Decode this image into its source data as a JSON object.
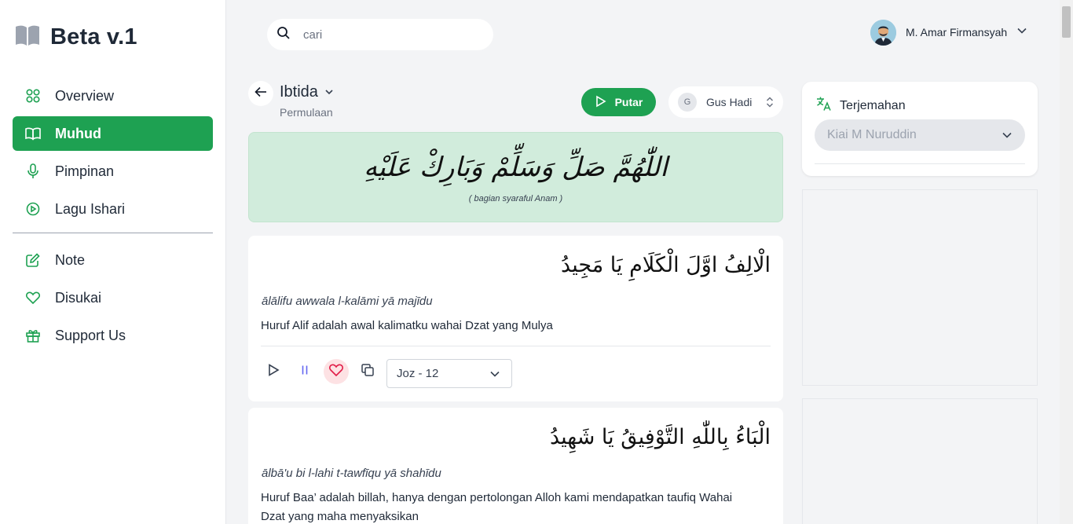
{
  "sidebar": {
    "brand": "Beta v.1",
    "items": [
      {
        "label": "Overview",
        "icon": "grid-icon"
      },
      {
        "label": "Muhud",
        "icon": "book-icon",
        "active": true
      },
      {
        "label": "Pimpinan",
        "icon": "microphone-icon"
      },
      {
        "label": "Lagu Ishari",
        "icon": "play-circle-icon"
      }
    ],
    "items2": [
      {
        "label": "Note",
        "icon": "edit-icon"
      },
      {
        "label": "Disukai",
        "icon": "heart-icon"
      },
      {
        "label": "Support Us",
        "icon": "gift-icon"
      }
    ]
  },
  "search": {
    "placeholder": "cari"
  },
  "user": {
    "name": "M. Amar Firmansyah"
  },
  "header": {
    "title": "Ibtida",
    "subtitle": "Permulaan",
    "play_label": "Putar",
    "reciter_initial": "G",
    "reciter_name": "Gus Hadi"
  },
  "banner": {
    "arabic": "اللّٰهُمَّ صَلِّ وَسَلِّمْ وَبَارِكْ عَلَيْهِ",
    "note": "( bagian syaraful Anam )"
  },
  "verses": [
    {
      "arabic": "الْالِفُ اوَّلَ الْكَلَامِ يَا مَجِيدُ",
      "translit": "ālālifu awwala l-kalāmi yā majīdu",
      "meaning": "Huruf Alif adalah awal kalimatku wahai Dzat yang Mulya",
      "juz": "Joz - 12"
    },
    {
      "arabic": "الْبَاءُ بِاللّٰهِ التَّوْفِيقُ يَا شَهِيدُ",
      "translit": "ālbā'u bi l-lahi t-tawfīqu yā shahīdu",
      "meaning": "Huruf Baa’ adalah billah, hanya dengan pertolongan Alloh kami mendapatkan taufiq Wahai Dzat yang maha menyaksikan"
    }
  ],
  "translation": {
    "title": "Terjemahan",
    "selected": "Kiai M Nuruddin"
  },
  "colors": {
    "accent": "#1ea152",
    "banner_bg": "#d1ecdc",
    "like_bg": "#fde2e4",
    "heart": "#e11d48",
    "pause": "#6366f1"
  }
}
